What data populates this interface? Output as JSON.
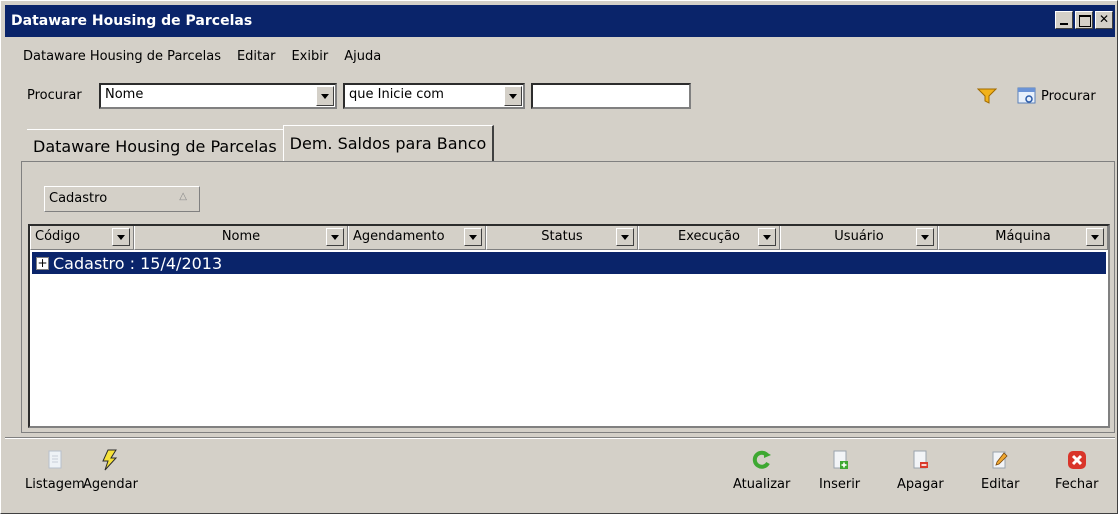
{
  "window": {
    "title": "Dataware Housing de Parcelas"
  },
  "menu": {
    "items": [
      "Dataware Housing de Parcelas",
      "Editar",
      "Exibir",
      "Ajuda"
    ]
  },
  "search": {
    "label": "Procurar",
    "field_value": "Nome",
    "condition_value": "que Inicie com",
    "text_value": "",
    "button_label": "Procurar"
  },
  "tabs": [
    {
      "label": "Dataware Housing de Parcelas",
      "active": false
    },
    {
      "label": "Dem. Saldos para Banco",
      "active": true
    }
  ],
  "group_chip": {
    "label": "Cadastro"
  },
  "grid": {
    "columns": [
      "Código",
      "Nome",
      "Agendamento",
      "Status",
      "Execução",
      "Usuário",
      "Máquina"
    ],
    "group_row": "Cadastro : 15/4/2013"
  },
  "toolbar": {
    "listagem": "Listagem",
    "agendar": "Agendar",
    "atualizar": "Atualizar",
    "inserir": "Inserir",
    "apagar": "Apagar",
    "editar": "Editar",
    "fechar": "Fechar"
  },
  "colors": {
    "titlebar": "#0a246a",
    "selection": "#0a246a",
    "face": "#d4d0c8"
  }
}
